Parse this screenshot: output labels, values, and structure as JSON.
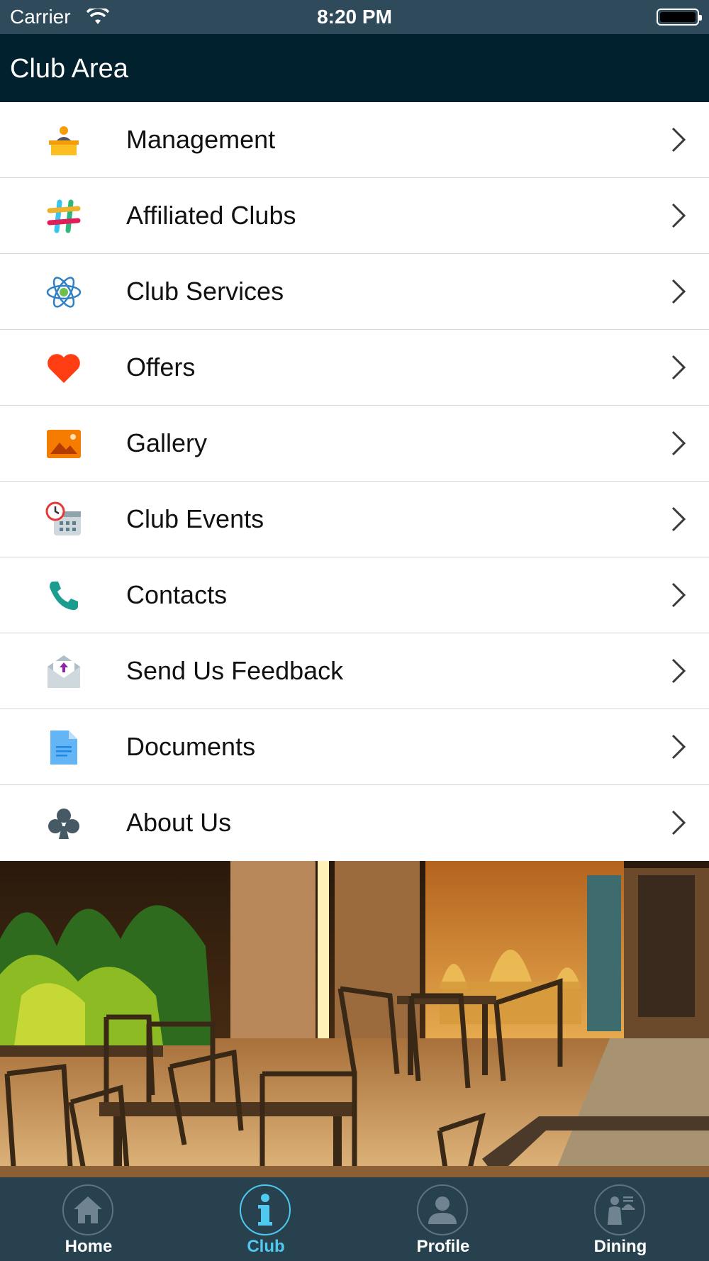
{
  "status_bar": {
    "carrier": "Carrier",
    "time": "8:20 PM"
  },
  "nav": {
    "title": "Club Area"
  },
  "menu": {
    "items": [
      {
        "label": "Management",
        "icon": "reception-desk-icon"
      },
      {
        "label": "Affiliated Clubs",
        "icon": "hashtag-icon"
      },
      {
        "label": "Club Services",
        "icon": "atom-icon"
      },
      {
        "label": "Offers",
        "icon": "heart-icon"
      },
      {
        "label": "Gallery",
        "icon": "image-icon"
      },
      {
        "label": "Club Events",
        "icon": "calendar-clock-icon"
      },
      {
        "label": "Contacts",
        "icon": "phone-icon"
      },
      {
        "label": "Send Us Feedback",
        "icon": "mail-upload-icon"
      },
      {
        "label": "Documents",
        "icon": "document-icon"
      },
      {
        "label": "About Us",
        "icon": "club-icon"
      }
    ]
  },
  "tabs": [
    {
      "label": "Home",
      "icon": "home-icon"
    },
    {
      "label": "Club",
      "icon": "info-icon",
      "active": true
    },
    {
      "label": "Profile",
      "icon": "profile-icon"
    },
    {
      "label": "Dining",
      "icon": "dining-icon"
    }
  ],
  "colors": {
    "nav_bg": "#02212e",
    "status_bg": "#2f4a5a",
    "tab_bg": "#27414f",
    "tab_active": "#50c8ef"
  }
}
